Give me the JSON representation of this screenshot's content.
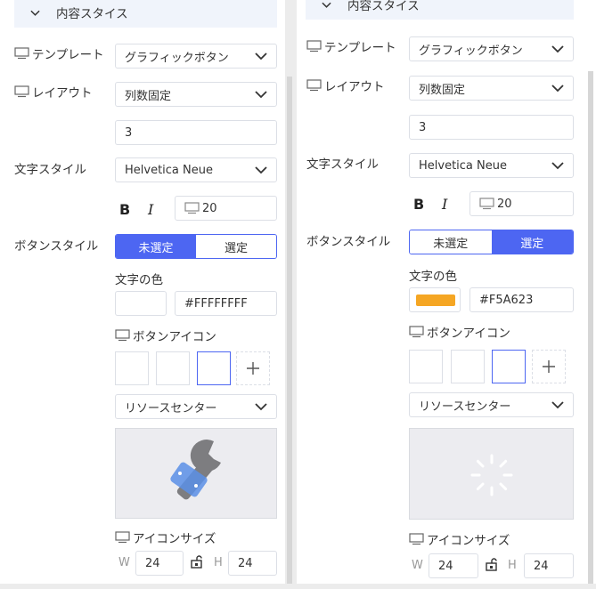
{
  "left": {
    "section_title": "内容スタイス",
    "template_label": "テンプレート",
    "template_value": "グラフィックボタン",
    "layout_label": "レイアウト",
    "layout_value": "列数固定",
    "columns_value": "3",
    "text_style_label": "文字スタイル",
    "font_value": "Helvetica Neue",
    "bold_glyph": "B",
    "italic_glyph": "I",
    "font_size": "20",
    "button_style_label": "ボタンスタイル",
    "seg_unselected": "未選定",
    "seg_selected": "選定",
    "text_color_label": "文字の色",
    "color_value": "#FFFFFFFF",
    "swatch_color": "#ffffff",
    "button_icon_label": "ボタンアイコン",
    "resource_value": "リソースセンター",
    "icon_size_label": "アイコンサイズ",
    "w_label": "W",
    "w_value": "24",
    "h_label": "H",
    "h_value": "24",
    "active_segment": "unselected",
    "preview_icon": "wrench-icon"
  },
  "right": {
    "section_title": "内容スタイス",
    "template_label": "テンプレート",
    "template_value": "グラフィックボタン",
    "layout_label": "レイアウト",
    "layout_value": "列数固定",
    "columns_value": "3",
    "text_style_label": "文字スタイル",
    "font_value": "Helvetica Neue",
    "bold_glyph": "B",
    "italic_glyph": "I",
    "font_size": "20",
    "button_style_label": "ボタンスタイル",
    "seg_unselected": "未選定",
    "seg_selected": "選定",
    "text_color_label": "文字の色",
    "color_value": "#F5A623",
    "swatch_color": "#f5a623",
    "button_icon_label": "ボタンアイコン",
    "resource_value": "リソースセンター",
    "icon_size_label": "アイコンサイズ",
    "w_label": "W",
    "w_value": "24",
    "h_label": "H",
    "h_value": "24",
    "active_segment": "selected",
    "preview_icon": "loading-spinner-icon"
  },
  "colors": {
    "accent": "#4d66f2",
    "section_bg": "#f0f4fb"
  }
}
